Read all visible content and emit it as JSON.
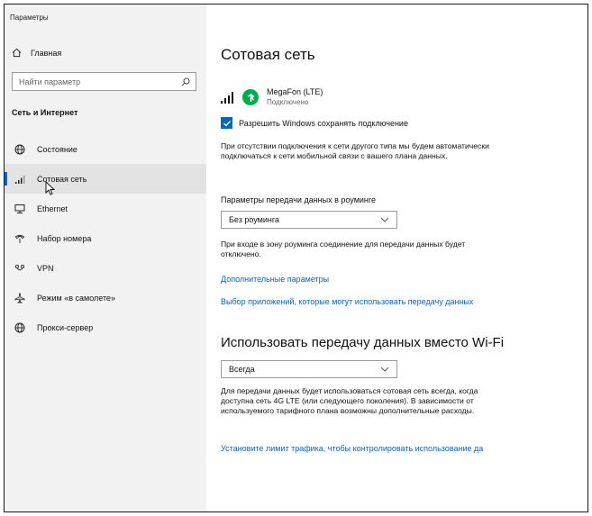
{
  "window": {
    "title": "Параметры"
  },
  "sidebar": {
    "home_label": "Главная",
    "search_placeholder": "Найти параметр",
    "section_title": "Сеть и Интернет",
    "items": [
      {
        "label": "Состояние",
        "icon": "globe-icon",
        "active": false
      },
      {
        "label": "Сотовая сеть",
        "icon": "cellular-icon",
        "active": true
      },
      {
        "label": "Ethernet",
        "icon": "ethernet-icon",
        "active": false
      },
      {
        "label": "Набор номера",
        "icon": "phone-icon",
        "active": false
      },
      {
        "label": "VPN",
        "icon": "vpn-icon",
        "active": false
      },
      {
        "label": "Режим «в самолете»",
        "icon": "airplane-icon",
        "active": false
      },
      {
        "label": "Прокси-сервер",
        "icon": "proxy-globe-icon",
        "active": false
      }
    ]
  },
  "main": {
    "title": "Сотовая сеть",
    "network": {
      "name": "MegaFon (LTE)",
      "status": "Подключено"
    },
    "keep_connection_label": "Разрешить Windows сохранять подключение",
    "keep_connection_checked": true,
    "fallback_text": "При отсутствии подключения к сети другого типа мы будем автоматически подключаться к сети мобильной связи с вашего плана данных.",
    "roaming": {
      "label": "Параметры передачи данных в роуминге",
      "selected": "Без роуминга",
      "note": "При входе в зону роуминга соединение для передачи данных будет отключено."
    },
    "links": {
      "advanced": "Дополнительные параметры",
      "apps": "Выбор приложений, которые могут использовать передачу данных"
    },
    "wifi_section": {
      "title": "Использовать передачу данных вместо Wi-Fi",
      "selected": "Всегда",
      "note": "Для передачи данных будет использоваться сотовая сеть всегда, когда доступна сеть 4G LTE (или следующего поколения). В зависимости от используемого тарифного плана возможны дополнительные расходы.",
      "limit_link": "Установите лимит трафика, чтобы контролировать использование да"
    }
  },
  "colors": {
    "accent": "#0067c0",
    "link": "#0a63b4",
    "brand": "#00a84f",
    "sidebar_bg": "#f2f2f2"
  }
}
